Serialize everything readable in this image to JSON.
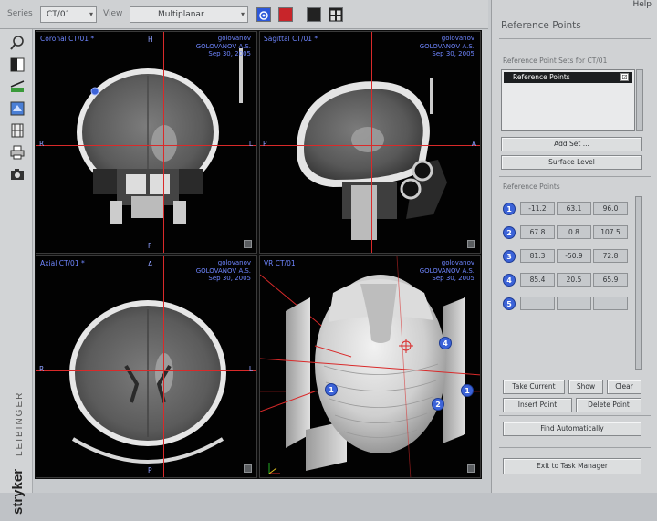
{
  "toolbar": {
    "series_label": "Series",
    "series_value": "CT/01",
    "view_label": "View",
    "view_value": "Multiplanar"
  },
  "viewports": {
    "coronal": {
      "title": "Coronal CT/01 *",
      "info": [
        "golovanov",
        "GOLOVANOV A.S.",
        "Sep 30, 2005"
      ],
      "top": "H",
      "bottom": "F",
      "left": "R",
      "right": "L"
    },
    "sagittal": {
      "title": "Sagittal CT/01 *",
      "info": [
        "golovanov",
        "GOLOVANOV A.S.",
        "Sep 30, 2005"
      ],
      "left": "P",
      "right": "A"
    },
    "axial": {
      "title": "Axial CT/01 *",
      "info": [
        "golovanov",
        "GOLOVANOV A.S.",
        "Sep 30, 2005"
      ],
      "top": "A",
      "bottom": "P",
      "left": "R",
      "right": "L"
    },
    "vr": {
      "title": "VR CT/01",
      "info": [
        "golovanov",
        "GOLOVANOV A.S.",
        "Sep 30, 2005"
      ],
      "markers": [
        "1",
        "2",
        "4",
        "1"
      ]
    }
  },
  "panel": {
    "help": "Help",
    "title": "Reference Points",
    "set_group_label": "Reference Point Sets for  CT/01",
    "set_item": "Reference Points",
    "set_checked": "☑",
    "add_set": "Add Set ...",
    "surface_level": "Surface Level",
    "points_label": "Reference Points",
    "points": [
      {
        "n": "1",
        "x": "-11.2",
        "y": "63.1",
        "z": "96.0"
      },
      {
        "n": "2",
        "x": "67.8",
        "y": "0.8",
        "z": "107.5"
      },
      {
        "n": "3",
        "x": "81.3",
        "y": "-50.9",
        "z": "72.8"
      },
      {
        "n": "4",
        "x": "85.4",
        "y": "20.5",
        "z": "65.9"
      },
      {
        "n": "5",
        "x": "",
        "y": "",
        "z": ""
      }
    ],
    "take_current": "Take Current",
    "show": "Show",
    "clear": "Clear",
    "insert_point": "Insert Point",
    "delete_point": "Delete Point",
    "find_auto": "Find Automatically",
    "exit": "Exit to Task Manager"
  },
  "brand": {
    "name": "stryker",
    "sub": "LEIBINGER"
  },
  "colors": {
    "crosshair": "#d92a2a",
    "overlay_text": "#6f86ff",
    "marker": "#3c63d8"
  }
}
